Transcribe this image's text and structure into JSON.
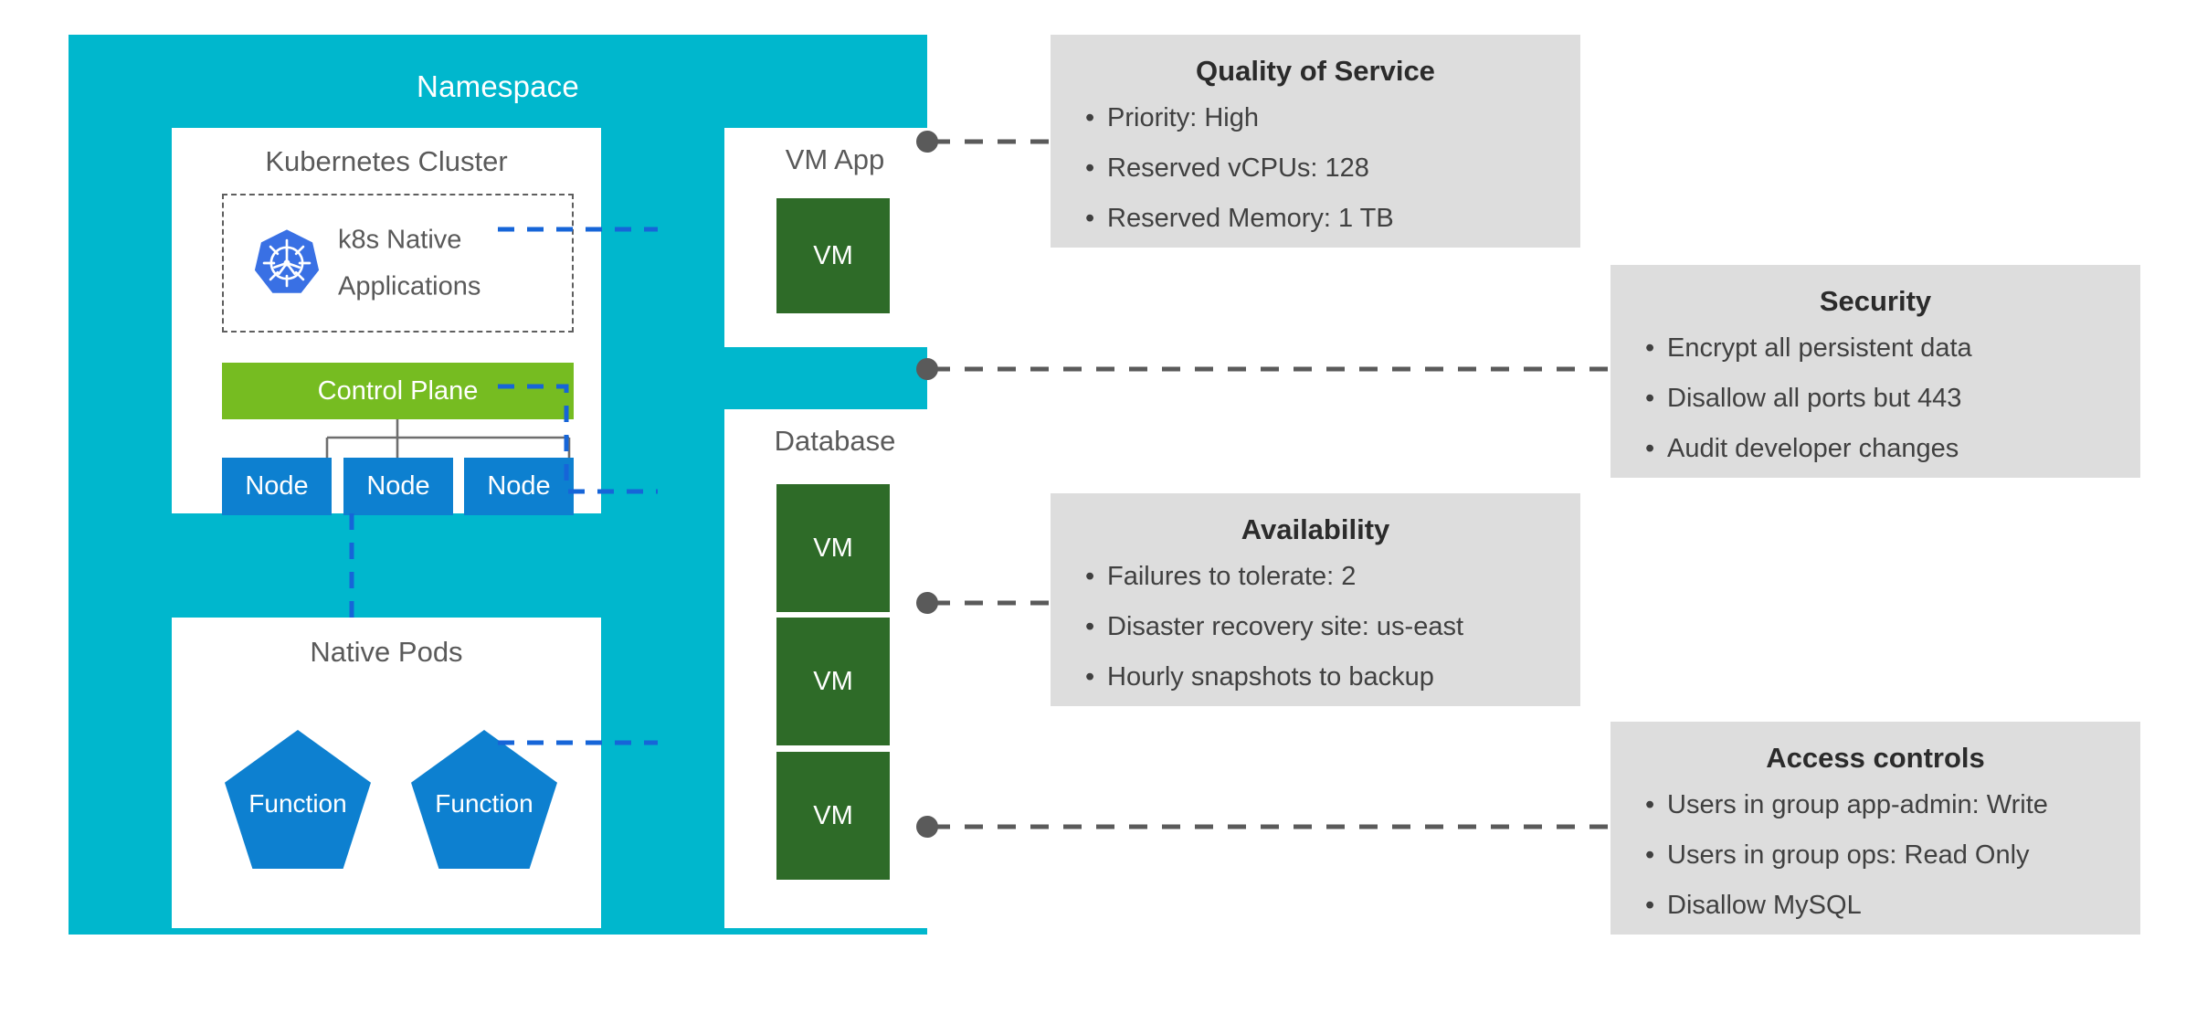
{
  "diagram": {
    "namespace": {
      "title": "Namespace",
      "color": "#00b7cd"
    },
    "k8s_cluster": {
      "title": "Kubernetes Cluster",
      "native_apps": {
        "logo": "kubernetes-logo",
        "line1": "k8s Native",
        "line2": "Applications"
      },
      "control_plane": {
        "label": "Control Plane",
        "color": "#76bc21"
      },
      "nodes": [
        {
          "label": "Node"
        },
        {
          "label": "Node"
        },
        {
          "label": "Node"
        }
      ],
      "node_color": "#0d80d0"
    },
    "native_pods": {
      "title": "Native Pods",
      "functions": [
        {
          "label": "Function"
        },
        {
          "label": "Function"
        }
      ],
      "function_color": "#0d80d0"
    },
    "vm_app": {
      "title": "VM App",
      "vms": [
        {
          "label": "VM"
        }
      ],
      "vm_color": "#2e6b28"
    },
    "database": {
      "title": "Database",
      "vms": [
        {
          "label": "VM"
        },
        {
          "label": "VM"
        },
        {
          "label": "VM"
        }
      ],
      "vm_color": "#2e6b28"
    }
  },
  "policy_boxes": [
    {
      "id": "quality-of-service",
      "title": "Quality of Service",
      "items": [
        "Priority: High",
        "Reserved vCPUs: 128",
        "Reserved Memory: 1 TB"
      ]
    },
    {
      "id": "security",
      "title": "Security",
      "items": [
        "Encrypt all persistent data",
        "Disallow all ports but 443",
        "Audit developer changes"
      ]
    },
    {
      "id": "availability",
      "title": "Availability",
      "items": [
        "Failures to tolerate: 2",
        "Disaster recovery site: us-east",
        "Hourly snapshots to backup"
      ]
    },
    {
      "id": "access-controls",
      "title": "Access controls",
      "items": [
        "Users in group app-admin: Write",
        "Users in group ops: Read Only",
        "Disallow MySQL"
      ]
    }
  ],
  "bullet_glyph": "•",
  "colors": {
    "namespace_teal": "#00b7cd",
    "panel_white": "#ffffff",
    "control_plane_green": "#76bc21",
    "node_blue": "#0d80d0",
    "vm_green": "#2e6b28",
    "info_box_gray": "#dddddd",
    "connector_gray": "#5a5a5a",
    "dashed_blue": "#1665d8",
    "text_gray": "#5a5a5a",
    "k8s_logo_blue": "#3970e4"
  }
}
